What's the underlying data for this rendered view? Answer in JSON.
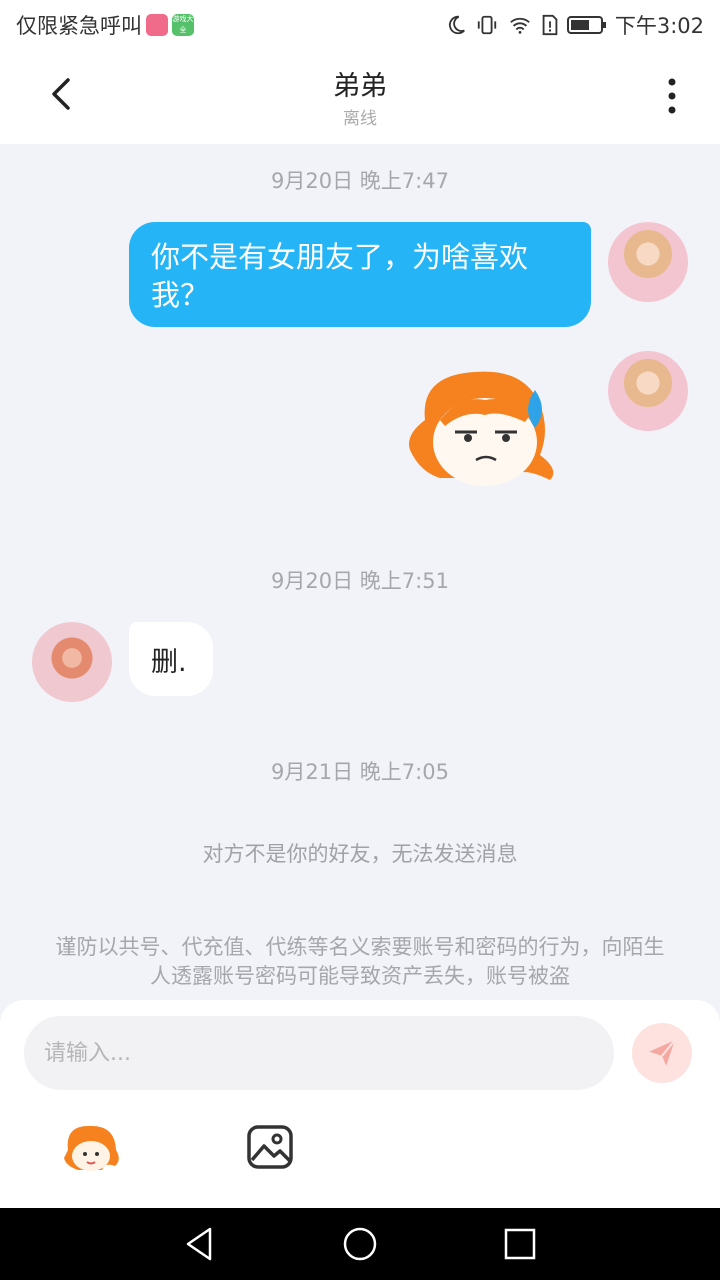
{
  "status_bar": {
    "carrier": "仅限紧急呼叫",
    "badge2_text": "游戏大全",
    "time": "下午3:02"
  },
  "header": {
    "title": "弟弟",
    "subtitle": "离线"
  },
  "messages": [
    {
      "time": "9月20日 晚上7:47",
      "text": "你不是有女朋友了，为啥喜欢我？"
    },
    {
      "time": "9月20日 晚上7:51",
      "text": "删."
    },
    {
      "time": "9月21日 晚上7:05"
    }
  ],
  "notice": "对方不是你的好友，无法发送消息",
  "warning": "谨防以共号、代充值、代练等名义索要账号和密码的行为，向陌生人透露账号密码可能导致资产丢失，账号被盗",
  "input": {
    "placeholder": "请输入..."
  },
  "colors": {
    "bubble_me": "#25b4f5",
    "send_bg": "#fde2df",
    "sticker_orange": "#f5821f"
  }
}
